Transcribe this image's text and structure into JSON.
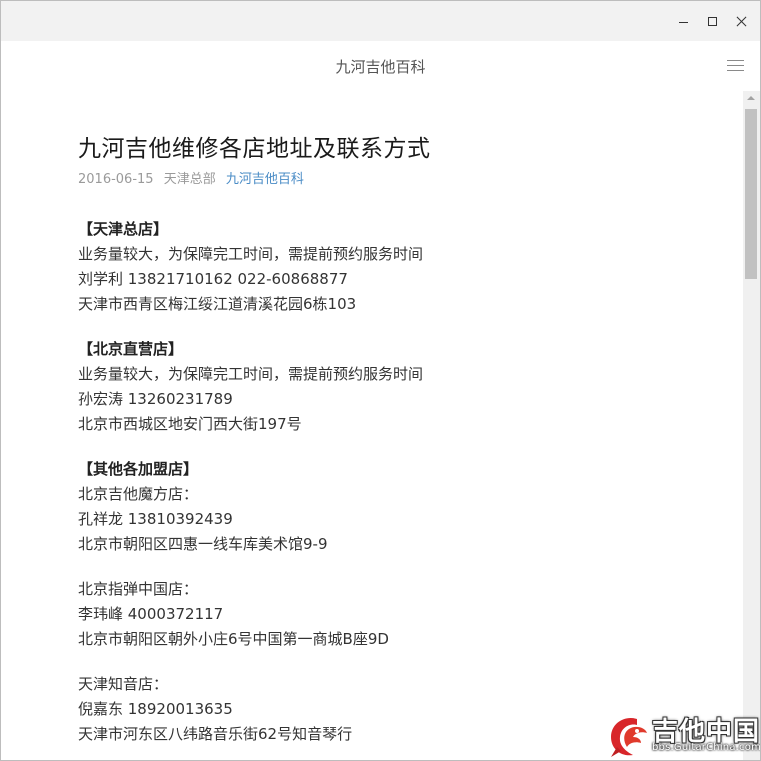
{
  "window": {
    "controls": {
      "minimize": "minimize-icon",
      "maximize": "maximize-icon",
      "close": "close-icon"
    }
  },
  "header": {
    "title": "九河吉他百科",
    "menu_icon": "hamburger-menu-icon"
  },
  "article": {
    "title": "九河吉他维修各店地址及联系方式",
    "date": "2016-06-15",
    "author": "天津总部",
    "source": "九河吉他百科",
    "sections": [
      {
        "lines": [
          "【天津总店】",
          "业务量较大，为保障完工时间，需提前预约服务时间",
          "刘学利 13821710162 022-60868877",
          "天津市西青区梅江绥江道清溪花园6栋103"
        ]
      },
      {
        "lines": [
          "【北京直营店】",
          "业务量较大，为保障完工时间，需提前预约服务时间",
          "孙宏涛 13260231789",
          "北京市西城区地安门西大街197号"
        ]
      },
      {
        "lines": [
          "【其他各加盟店】",
          "北京吉他魔方店：",
          "孔祥龙 13810392439",
          "北京市朝阳区四惠一线车库美术馆9-9"
        ]
      },
      {
        "lines": [
          "北京指弹中国店：",
          "李玮峰 4000372117",
          "北京市朝阳区朝外小庄6号中国第一商城B座9D"
        ]
      },
      {
        "lines": [
          "天津知音店：",
          "倪嘉东 18920013635",
          "天津市河东区八纬路音乐街62号知音琴行"
        ]
      }
    ]
  },
  "watermark": {
    "text": "吉他中国",
    "url": "bbs.GuitarChina.com",
    "logo_icon": "guitarchina-dragon-logo-icon"
  },
  "colors": {
    "titlebar_bg": "#f2f2f2",
    "link": "#4a8cc6",
    "meta": "#9a9a9a",
    "body_text": "#333333"
  }
}
